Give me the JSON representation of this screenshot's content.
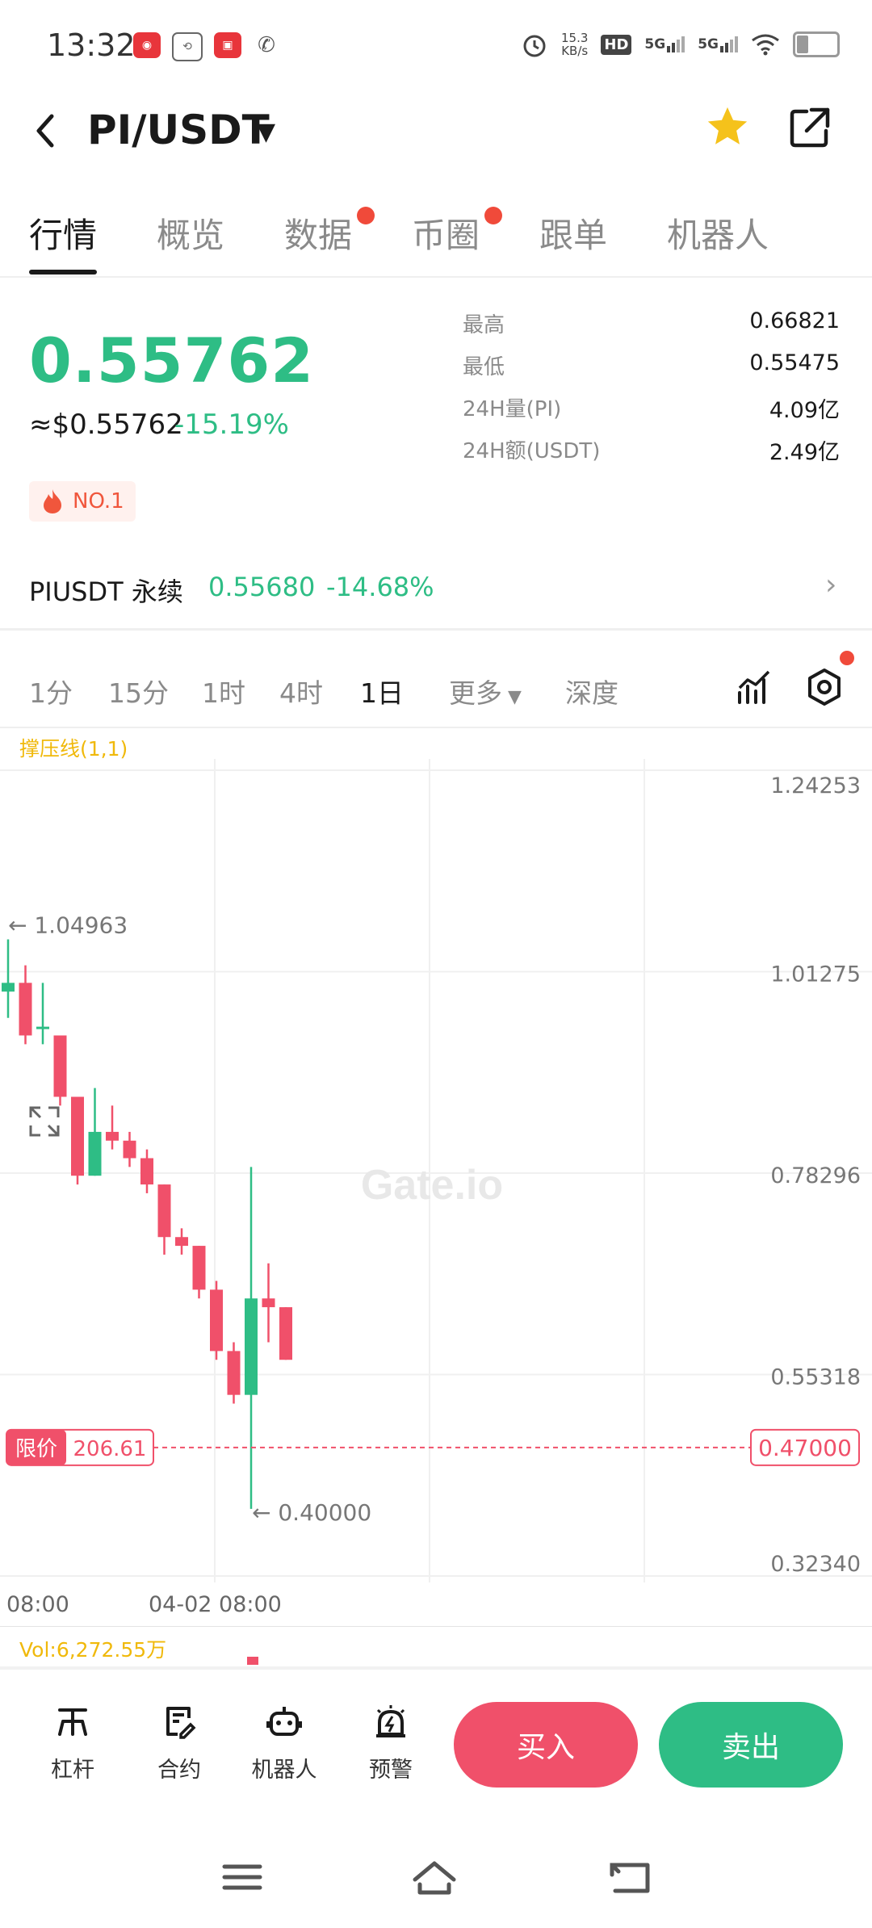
{
  "status_bar": {
    "time": "13:32",
    "net_speed_value": "15.3",
    "net_speed_unit": "KB/s",
    "hd_label": "HD",
    "sim1": "5G",
    "sim2": "5G",
    "battery_level": 0.25,
    "notif_icons": [
      "xiaohongshu-app-icon",
      "sync-app-icon",
      "mall-app-icon",
      "wechat-icon"
    ]
  },
  "header": {
    "pair": "PI/USDT",
    "favorite": true,
    "favorite_color": "#f5c21b"
  },
  "tabs": [
    {
      "label": "行情",
      "active": true,
      "dot": false
    },
    {
      "label": "概览",
      "active": false,
      "dot": false
    },
    {
      "label": "数据",
      "active": false,
      "dot": true
    },
    {
      "label": "币圈",
      "active": false,
      "dot": true
    },
    {
      "label": "跟单",
      "active": false,
      "dot": false
    },
    {
      "label": "机器人",
      "active": false,
      "dot": false
    }
  ],
  "ticker": {
    "price": "0.55762",
    "usd_price": "≈$0.55762",
    "change_pct": "-15.19%",
    "rank": "NO.1",
    "stats": [
      {
        "label": "最高",
        "value": "0.66821"
      },
      {
        "label": "最低",
        "value": "0.55475"
      },
      {
        "label": "24H量(PI)",
        "value": "4.09亿"
      },
      {
        "label": "24H额(USDT)",
        "value": "2.49亿"
      }
    ]
  },
  "perpetual": {
    "name": "PIUSDT 永续",
    "price": "0.55680",
    "change_pct": "-14.68%"
  },
  "intervals": {
    "items": [
      "1分",
      "15分",
      "1时",
      "4时",
      "1日",
      "更多",
      "深度"
    ],
    "active": "1日"
  },
  "chart": {
    "indicator_label": "撑压线(1,1)",
    "watermark": "Gate.io",
    "y_ticks": [
      "1.24253",
      "1.01275",
      "0.78296",
      "0.55318",
      "0.32340"
    ],
    "x_ticks": [
      "08:00",
      "04-02 08:00"
    ],
    "high_marker": "← 1.04963",
    "low_marker": "← 0.40000",
    "limit_label": "限价",
    "limit_qty": "206.61",
    "limit_price": "0.47000",
    "vol_label": "Vol:6,272.55万",
    "up_color": "#2ebd85",
    "down_color": "#f0506a"
  },
  "chart_data": {
    "type": "candlestick",
    "ylim": [
      0.3234,
      1.24253
    ],
    "x_labels": [
      "08:00",
      "04-02 08:00"
    ],
    "candles": [
      {
        "open": 0.99,
        "high": 1.0496,
        "low": 0.96,
        "close": 1.0
      },
      {
        "open": 1.0,
        "high": 1.02,
        "low": 0.93,
        "close": 0.94
      },
      {
        "open": 0.95,
        "high": 1.0,
        "low": 0.93,
        "close": 0.95
      },
      {
        "open": 0.94,
        "high": 0.94,
        "low": 0.86,
        "close": 0.87
      },
      {
        "open": 0.87,
        "high": 0.87,
        "low": 0.77,
        "close": 0.78
      },
      {
        "open": 0.78,
        "high": 0.88,
        "low": 0.78,
        "close": 0.83
      },
      {
        "open": 0.83,
        "high": 0.86,
        "low": 0.81,
        "close": 0.82
      },
      {
        "open": 0.82,
        "high": 0.83,
        "low": 0.79,
        "close": 0.8
      },
      {
        "open": 0.8,
        "high": 0.81,
        "low": 0.76,
        "close": 0.77
      },
      {
        "open": 0.77,
        "high": 0.77,
        "low": 0.69,
        "close": 0.71
      },
      {
        "open": 0.71,
        "high": 0.72,
        "low": 0.69,
        "close": 0.7
      },
      {
        "open": 0.7,
        "high": 0.7,
        "low": 0.64,
        "close": 0.65
      },
      {
        "open": 0.65,
        "high": 0.66,
        "low": 0.57,
        "close": 0.58
      },
      {
        "open": 0.58,
        "high": 0.59,
        "low": 0.52,
        "close": 0.53
      },
      {
        "open": 0.53,
        "high": 0.79,
        "low": 0.4,
        "close": 0.64
      },
      {
        "open": 0.64,
        "high": 0.68,
        "low": 0.59,
        "close": 0.63
      },
      {
        "open": 0.63,
        "high": 0.63,
        "low": 0.57,
        "close": 0.57
      }
    ],
    "markers": {
      "high": 1.04963,
      "low": 0.4,
      "limit_price": 0.47
    }
  },
  "bottom_bar": {
    "items": [
      {
        "label": "杠杆",
        "icon": "leverage-icon"
      },
      {
        "label": "合约",
        "icon": "contract-icon"
      },
      {
        "label": "机器人",
        "icon": "robot-icon"
      },
      {
        "label": "预警",
        "icon": "alert-icon"
      }
    ],
    "buy_label": "买入",
    "sell_label": "卖出"
  }
}
